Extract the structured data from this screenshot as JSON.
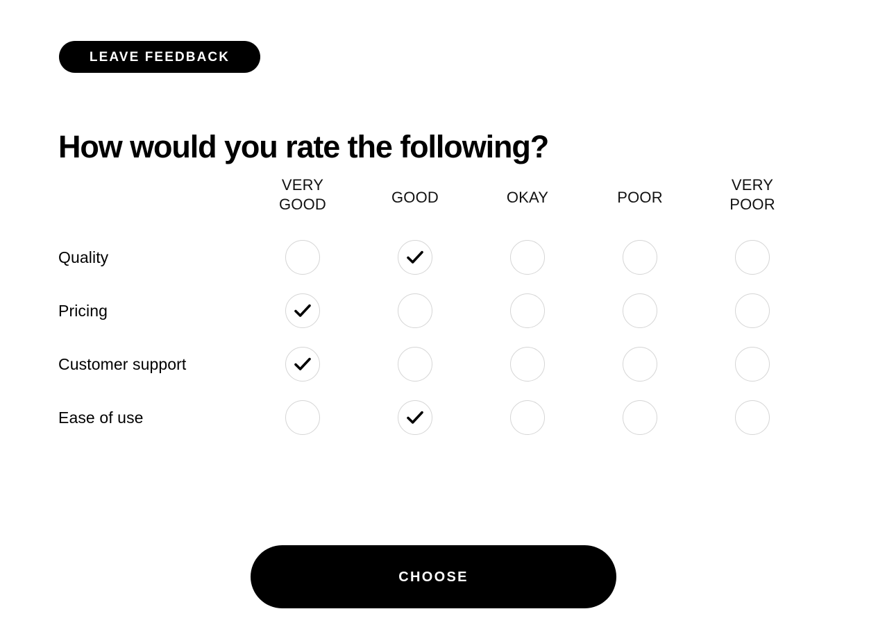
{
  "badge": {
    "label": "LEAVE FEEDBACK",
    "background_color": "#000000",
    "text_color": "#ffffff"
  },
  "heading": {
    "text": "How would you rate the following?"
  },
  "matrix": {
    "columns": [
      {
        "id": "very-good",
        "label": "VERY GOOD",
        "lines": [
          "VERY",
          "GOOD"
        ]
      },
      {
        "id": "good",
        "label": "GOOD",
        "lines": [
          "GOOD"
        ]
      },
      {
        "id": "okay",
        "label": "OKAY",
        "lines": [
          "OKAY"
        ]
      },
      {
        "id": "poor",
        "label": "POOR",
        "lines": [
          "POOR"
        ]
      },
      {
        "id": "very-poor",
        "label": "VERY POOR",
        "lines": [
          "VERY",
          "POOR"
        ]
      }
    ],
    "rows": [
      {
        "id": "quality",
        "label": "Quality",
        "selected": 1
      },
      {
        "id": "pricing",
        "label": "Pricing",
        "selected": 0
      },
      {
        "id": "customer-support",
        "label": "Customer support",
        "selected": 0
      },
      {
        "id": "ease-of-use",
        "label": "Ease of use",
        "selected": 1
      }
    ],
    "circle_border_color": "#d5d5d5",
    "check_color": "#000000",
    "check_icon": "check-icon"
  },
  "submit": {
    "label": "CHOOSE",
    "background_color": "#000000",
    "text_color": "#ffffff"
  },
  "page": {
    "background_color": "#ffffff"
  }
}
